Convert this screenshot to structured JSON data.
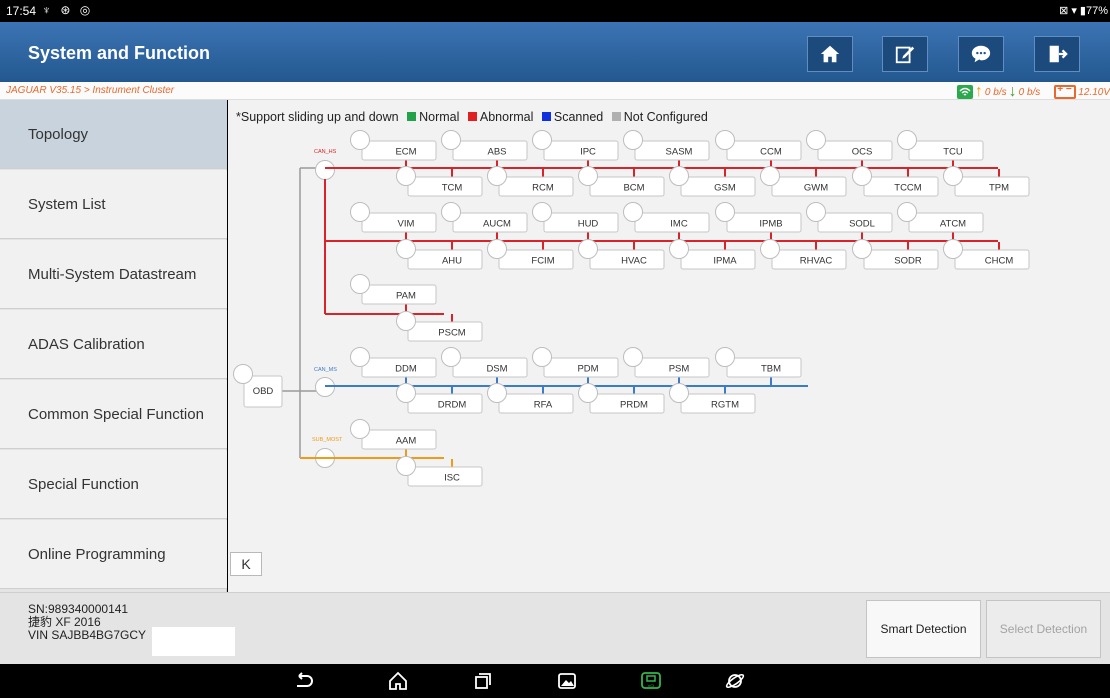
{
  "statusbar": {
    "time": "17:54",
    "icons": "♆ ⊛ ◎",
    "right": "⊠ ▾ ▮77%"
  },
  "header": {
    "title": "System and Function",
    "buttons": [
      "home-icon",
      "edit-report-icon",
      "feedback-icon",
      "exit-icon"
    ]
  },
  "breadcrumb": "JAGUAR V35.15 > Instrument Cluster",
  "net": {
    "up": "0 b/s",
    "down": "0 b/s",
    "voltage": "12.10V"
  },
  "sidebar": {
    "items": [
      {
        "label": "Topology"
      },
      {
        "label": "System List"
      },
      {
        "label": "Multi-System Datastream"
      },
      {
        "label": "ADAS Calibration"
      },
      {
        "label": "Common Special Function"
      },
      {
        "label": "Special Function"
      },
      {
        "label": "Online Programming"
      }
    ]
  },
  "legend": {
    "prefix": "*Support sliding up and down",
    "items": [
      {
        "label": "Normal",
        "color": "#22a34a"
      },
      {
        "label": "Abnormal",
        "color": "#e02020"
      },
      {
        "label": "Scanned",
        "color": "#1030e0"
      },
      {
        "label": "Not Configured",
        "color": "#b0b0b0"
      }
    ]
  },
  "colors": {
    "can_hs": "#d9232a",
    "can_ms": "#3a7cc8",
    "sub_most": "#ee9a1a",
    "trunk": "#9a9a9a"
  },
  "topology": {
    "obd": "OBD",
    "buses": [
      {
        "name": "CAN_HS",
        "rows": [
          [
            "ECM",
            "ABS",
            "IPC",
            "SASM",
            "CCM",
            "OCS",
            "TCU"
          ],
          [
            "TCM",
            "RCM",
            "BCM",
            "GSM",
            "GWM",
            "TCCM",
            "TPM"
          ],
          [
            "VIM",
            "AUCM",
            "HUD",
            "IMC",
            "IPMB",
            "SODL",
            "ATCM"
          ],
          [
            "AHU",
            "FCIM",
            "HVAC",
            "IPMA",
            "RHVAC",
            "SODR",
            "CHCM"
          ],
          [
            "PAM"
          ],
          [
            "PSCM"
          ]
        ]
      },
      {
        "name": "CAN_MS",
        "rows": [
          [
            "DDM",
            "DSM",
            "PDM",
            "PSM",
            "TBM"
          ],
          [
            "DRDM",
            "RFA",
            "PRDM",
            "RGTM"
          ]
        ]
      },
      {
        "name": "SUB_MOST",
        "rows": [
          [
            "AAM"
          ],
          [
            "ISC"
          ]
        ]
      }
    ]
  },
  "collapse_label": "K",
  "footer": {
    "sn": "SN:989340000141",
    "model": "捷豹 XF 2016",
    "vin": "VIN SAJBB4BG7GCY",
    "smart_detection": "Smart Detection",
    "select_detection": "Select Detection"
  },
  "androidnav": [
    "back-icon",
    "home-icon",
    "recents-icon",
    "gallery-icon",
    "vci-icon",
    "browser-icon"
  ]
}
